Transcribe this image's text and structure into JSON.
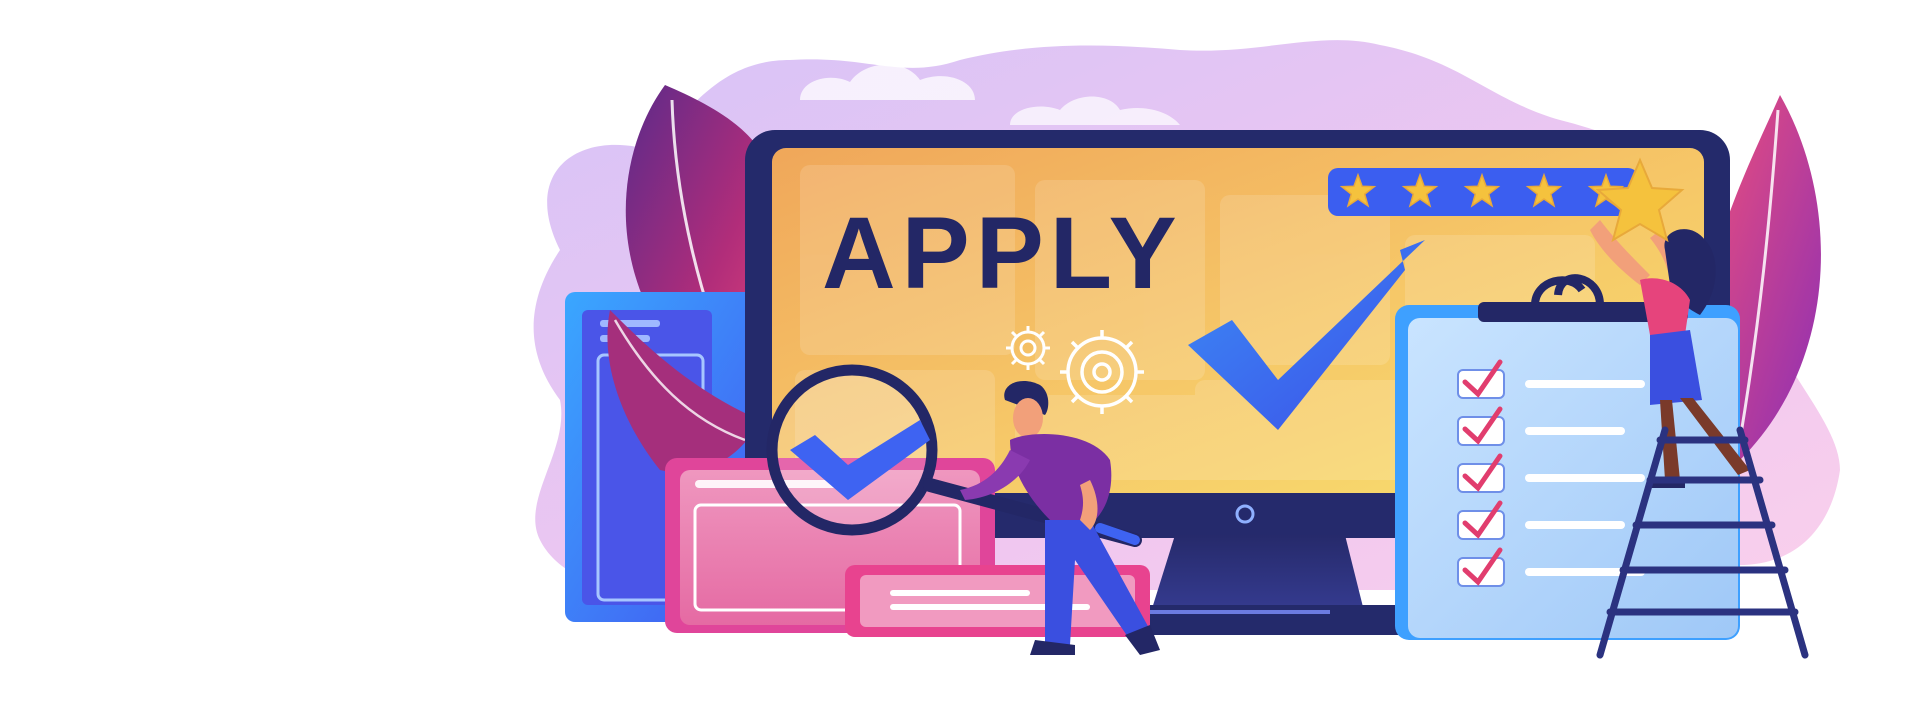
{
  "illustration": {
    "headline": "APPLY",
    "rating": {
      "stars_filled": 5,
      "stars_total": 5,
      "star_held": true
    },
    "checklist_items": 5,
    "colors": {
      "blob": "#e8c7f5",
      "monitor_frame": "#242a6b",
      "screen_top": "#f4b45a",
      "screen_bottom": "#f7d86b",
      "accent_blue": "#3e63f2",
      "leaf_pink": "#e2447a",
      "leaf_purple": "#7a2a8f",
      "card_pink": "#ec8fb6",
      "clipboard": "#b9dafb",
      "star": "#f5c23d",
      "check_pink": "#e13d6e"
    }
  }
}
